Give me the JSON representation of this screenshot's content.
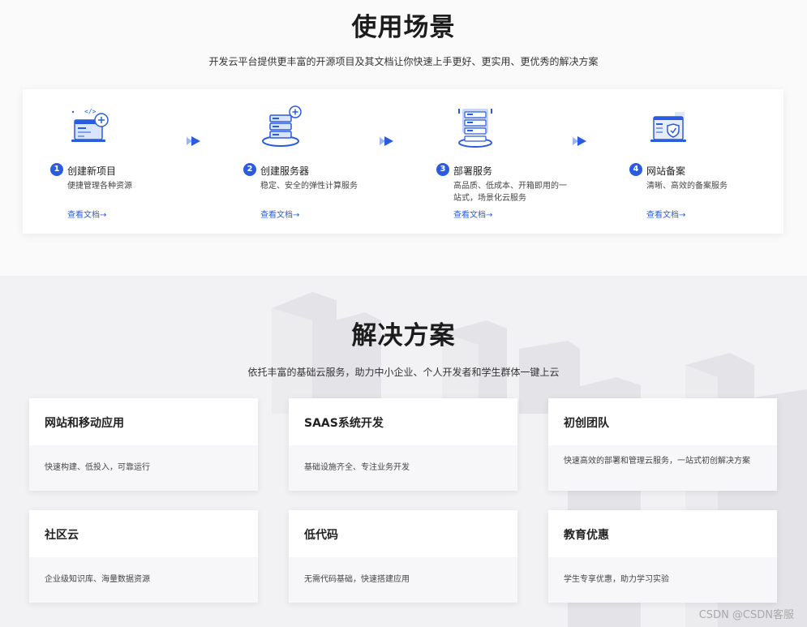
{
  "scenarios_section": {
    "title": "使用场景",
    "subtitle": "开发云平台提供更丰富的开源项目及其文档让你快速上手更好、更实用、更优秀的解决方案",
    "items": [
      {
        "num": "1",
        "title": "创建新项目",
        "desc": "便捷管理各种资源",
        "link": "查看文档→",
        "icon": "code-window-add-icon"
      },
      {
        "num": "2",
        "title": "创建服务器",
        "desc": "稳定、安全的弹性计算服务",
        "link": "查看文档→",
        "icon": "server-add-icon"
      },
      {
        "num": "3",
        "title": "部署服务",
        "desc": "高品质、低成本、开箱即用的一站式，场景化云服务",
        "link": "查看文档→",
        "icon": "server-deploy-icon"
      },
      {
        "num": "4",
        "title": "网站备案",
        "desc": "清晰、高效的备案服务",
        "link": "查看文档→",
        "icon": "website-filing-shield-icon"
      }
    ]
  },
  "solutions_section": {
    "title": "解决方案",
    "subtitle": "依托丰富的基础云服务，助力中小企业、个人开发者和学生群体一键上云",
    "items": [
      {
        "title": "网站和移动应用",
        "desc": "快速构建、低投入，可靠运行"
      },
      {
        "title": "SAAS系统开发",
        "desc": "基础设施齐全、专注业务开发"
      },
      {
        "title": "初创团队",
        "desc": "快速高效的部署和管理云服务，一站式初创解决方案"
      },
      {
        "title": "社区云",
        "desc": "企业级知识库、海量数据资源"
      },
      {
        "title": "低代码",
        "desc": "无需代码基础，快速搭建应用"
      },
      {
        "title": "教育优惠",
        "desc": "学生专享优惠，助力学习实验"
      }
    ]
  },
  "watermark": "CSDN @CSDN客服",
  "colors": {
    "accent": "#2a5cdf",
    "page_bg": "#fafafa",
    "section_bg": "#f2f2f4"
  }
}
